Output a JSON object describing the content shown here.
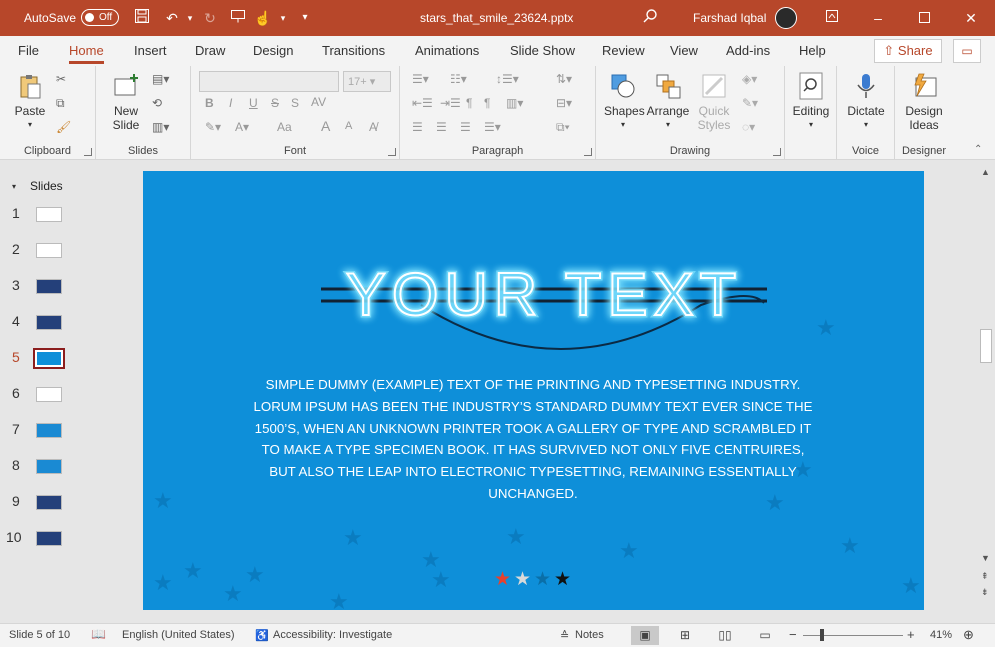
{
  "titlebar": {
    "autosave_label": "AutoSave",
    "autosave_state": "Off",
    "filename": "stars_that_smile_23624.pptx",
    "user_name": "Farshad Iqbal"
  },
  "menu": {
    "tabs": [
      "File",
      "Home",
      "Insert",
      "Draw",
      "Design",
      "Transitions",
      "Animations",
      "Slide Show",
      "Review",
      "View",
      "Add-ins",
      "Help"
    ],
    "active_tab": "Home",
    "share_label": "Share"
  },
  "ribbon": {
    "clipboard": {
      "label": "Clipboard",
      "paste": "Paste"
    },
    "slides": {
      "label": "Slides",
      "new_slide_line1": "New",
      "new_slide_line2": "Slide"
    },
    "font": {
      "label": "Font",
      "size_placeholder": "17+",
      "bold": "B",
      "italic": "I",
      "underline": "U",
      "strike": "S",
      "spacing": "AV",
      "case": "Aa",
      "grow": "A",
      "shrink": "A"
    },
    "paragraph": {
      "label": "Paragraph"
    },
    "drawing": {
      "label": "Drawing",
      "shapes": "Shapes",
      "arrange": "Arrange",
      "quick_styles_line1": "Quick",
      "quick_styles_line2": "Styles"
    },
    "editing": {
      "label": "Editing"
    },
    "voice": {
      "label": "Voice",
      "dictate": "Dictate"
    },
    "designer": {
      "label": "Designer",
      "design_ideas_line1": "Design",
      "design_ideas_line2": "Ideas"
    }
  },
  "thumbnails": {
    "header": "Slides",
    "items": [
      "1",
      "2",
      "3",
      "4",
      "5",
      "6",
      "7",
      "8",
      "9",
      "10"
    ],
    "current": 5
  },
  "slide": {
    "headline": "YOUR TEXT",
    "body": "SIMPLE DUMMY (EXAMPLE) TEXT OF THE PRINTING AND TYPESETTING INDUSTRY. LORUM IPSUM HAS BEEN THE INDUSTRY’S STANDARD DUMMY TEXT EVER SINCE THE 1500’S, WHEN AN UNKNOWN PRINTER TOOK A GALLERY OF TYPE AND SCRAMBLED IT TO MAKE A TYPE SPECIMEN BOOK. IT HAS SURVIVED NOT ONLY FIVE CENTRUIRES, BUT ALSO THE LEAP INTO ELECTRONIC TYPESETTING, REMAINING ESSENTIALLY UNCHANGED.",
    "rating_colors": [
      "#e8412c",
      "#d9d9d9",
      "#0a6fa8",
      "#111111"
    ],
    "background_color": "#0e8fd9"
  },
  "status": {
    "slide_counter": "Slide 5 of 10",
    "language": "English (United States)",
    "accessibility": "Accessibility: Investigate",
    "notes": "Notes",
    "zoom": "41%",
    "zoom_minus": "−",
    "zoom_plus": "+"
  },
  "colors": {
    "accent": "#b7472a",
    "ribbon_bg": "#f3f3f3"
  }
}
